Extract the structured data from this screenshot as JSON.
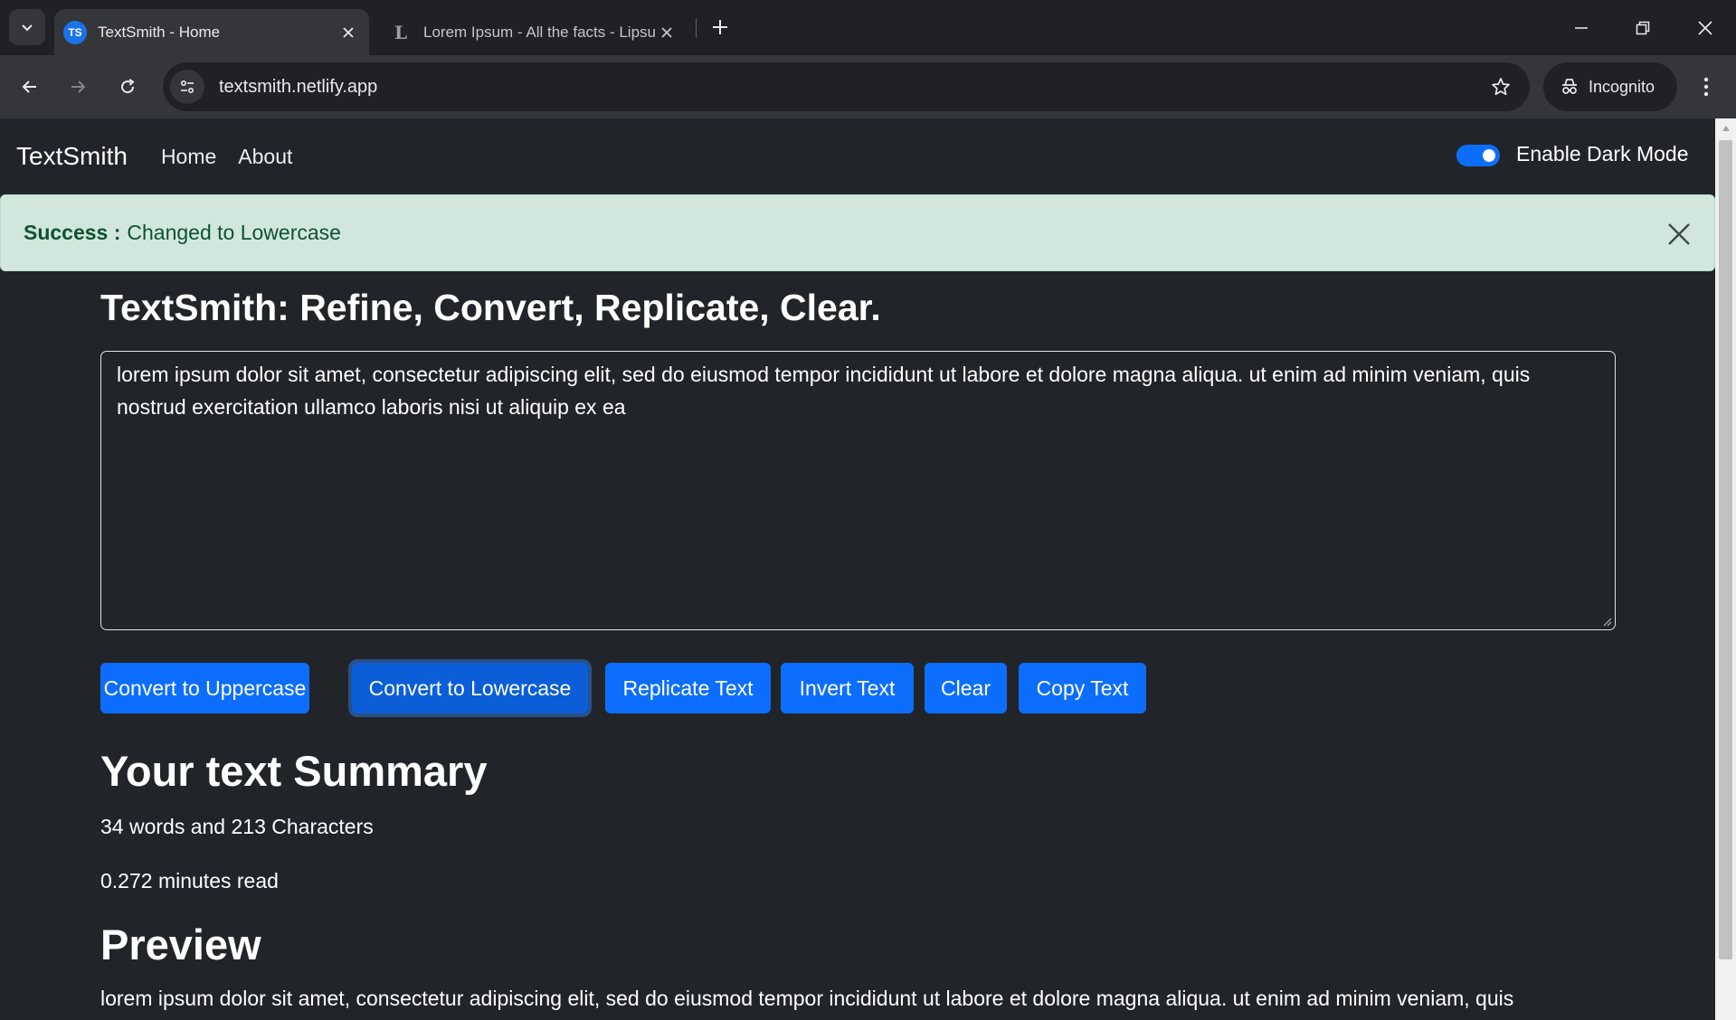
{
  "browser": {
    "tabs": [
      {
        "favicon": "TS",
        "title": "TextSmith - Home",
        "active": true
      },
      {
        "favicon": "L",
        "title": "Lorem Ipsum - All the facts - Lipsum",
        "active": false
      }
    ],
    "url": "textsmith.netlify.app",
    "incognito_label": "Incognito"
  },
  "navbar": {
    "brand": "TextSmith",
    "links": [
      "Home",
      "About"
    ],
    "dark_mode_label": "Enable Dark Mode",
    "dark_mode_enabled": true
  },
  "alert": {
    "type": "Success",
    "strong": "Success :",
    "message": "Changed to Lowercase"
  },
  "main": {
    "heading": "TextSmith: Refine, Convert, Replicate, Clear.",
    "text": "lorem ipsum dolor sit amet, consectetur adipiscing elit, sed do eiusmod tempor incididunt ut labore et dolore magna aliqua. ut enim ad minim veniam, quis nostrud exercitation ullamco laboris nisi ut aliquip ex ea",
    "buttons": [
      "Convert to Uppercase",
      "Convert to Lowercase",
      "Replicate Text",
      "Invert Text",
      "Clear",
      "Copy Text"
    ],
    "focused_button": "Convert to Lowercase"
  },
  "summary": {
    "heading": "Your text Summary",
    "counts": "34 words and 213 Characters",
    "read_time": "0.272 minutes read"
  },
  "preview": {
    "heading": "Preview",
    "text": "lorem ipsum dolor sit amet, consectetur adipiscing elit, sed do eiusmod tempor incididunt ut labore et dolore magna aliqua. ut enim ad minim veniam, quis"
  },
  "colors": {
    "primary": "#0d6efd",
    "page_bg": "#212529",
    "alert_bg": "#d1e7dd",
    "alert_text": "#0f5132"
  }
}
